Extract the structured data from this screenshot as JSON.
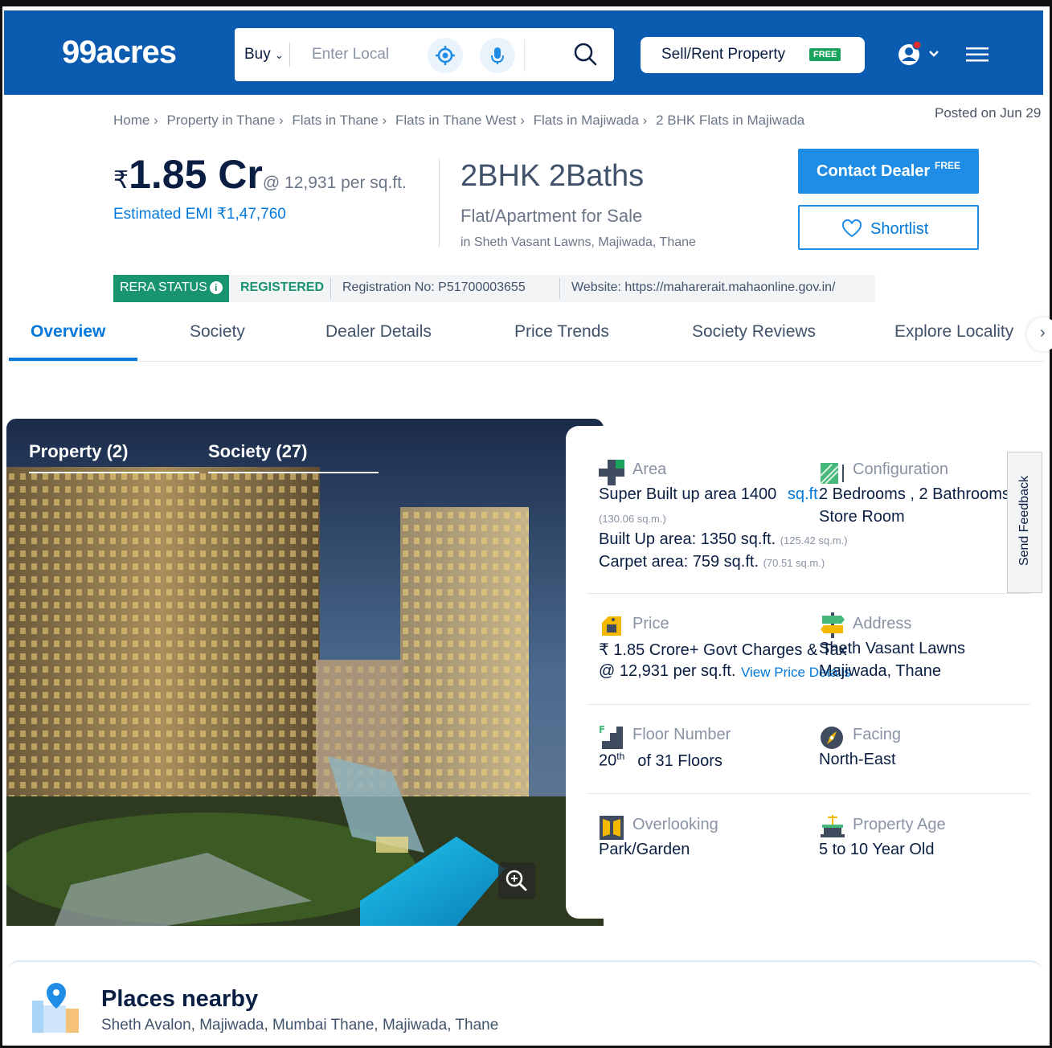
{
  "header": {
    "logo": "99acres",
    "search": {
      "buy_label": "Buy",
      "placeholder": "Enter Local"
    },
    "sell_rent_label": "Sell/Rent Property",
    "sell_rent_badge": "FREE",
    "brand_color": "#0b5bb0"
  },
  "breadcrumb": [
    "Home ›",
    "Property in Thane ›",
    "Flats in Thane ›",
    "Flats in Thane West ›",
    "Flats in Majiwada ›",
    "2 BHK Flats in Majiwada"
  ],
  "posted_on": "Posted on Jun 29",
  "listing": {
    "rupee": "₹",
    "price": "1.85 Cr",
    "per_sqft": "@ 12,931 per sq.ft.",
    "emi": "Estimated EMI ₹1,47,760",
    "title": "2BHK 2Baths",
    "type": "Flat/Apartment for Sale",
    "location": "in Sheth Vasant Lawns, Majiwada, Thane"
  },
  "actions": {
    "contact_label": "Contact Dealer",
    "contact_badge": "FREE",
    "shortlist_label": "Shortlist"
  },
  "rera": {
    "status_label": "RERA STATUS",
    "registered": "REGISTERED",
    "registration": "Registration No: P51700003655",
    "website": "Website: https://maharerait.mahaonline.gov.in/"
  },
  "tabs": [
    "Overview",
    "Society",
    "Dealer Details",
    "Price Trends",
    "Society Reviews",
    "Explore Locality"
  ],
  "gallery": {
    "tab_property": "Property (2)",
    "tab_society": "Society (27)"
  },
  "details": {
    "area": {
      "label": "Area",
      "super_built": "Super Built up area 1400",
      "super_unit": "sq.ft.",
      "super_sqm": "(130.06 sq.m.)",
      "built_up": "Built Up area: 1350 sq.ft.",
      "built_up_sqm": "(125.42 sq.m.)",
      "carpet": "Carpet area: 759 sq.ft.",
      "carpet_sqm": "(70.51 sq.m.)"
    },
    "configuration": {
      "label": "Configuration",
      "line1": "2 Bedrooms , 2 Bathrooms",
      "line2": "Store Room"
    },
    "price": {
      "label": "Price",
      "line1": "₹ 1.85 Crore+ Govt Charges & Tax",
      "line2": "@ 12,931 per sq.ft.",
      "link": "View Price Details"
    },
    "address": {
      "label": "Address",
      "line1": "Sheth Vasant Lawns",
      "line2": "Majiwada, Thane"
    },
    "floor": {
      "label": "Floor Number",
      "floor_num": "20",
      "floor_sup": "th",
      "floor_rest": "of 31 Floors"
    },
    "facing": {
      "label": "Facing",
      "value": "North-East"
    },
    "overlooking": {
      "label": "Overlooking",
      "value": "Park/Garden"
    },
    "age": {
      "label": "Property Age",
      "value": "5 to 10 Year Old"
    }
  },
  "feedback_label": "Send Feedback",
  "places": {
    "title": "Places nearby",
    "subtitle": "Sheth Avalon, Majiwada, Mumbai Thane, Majiwada, Thane"
  }
}
